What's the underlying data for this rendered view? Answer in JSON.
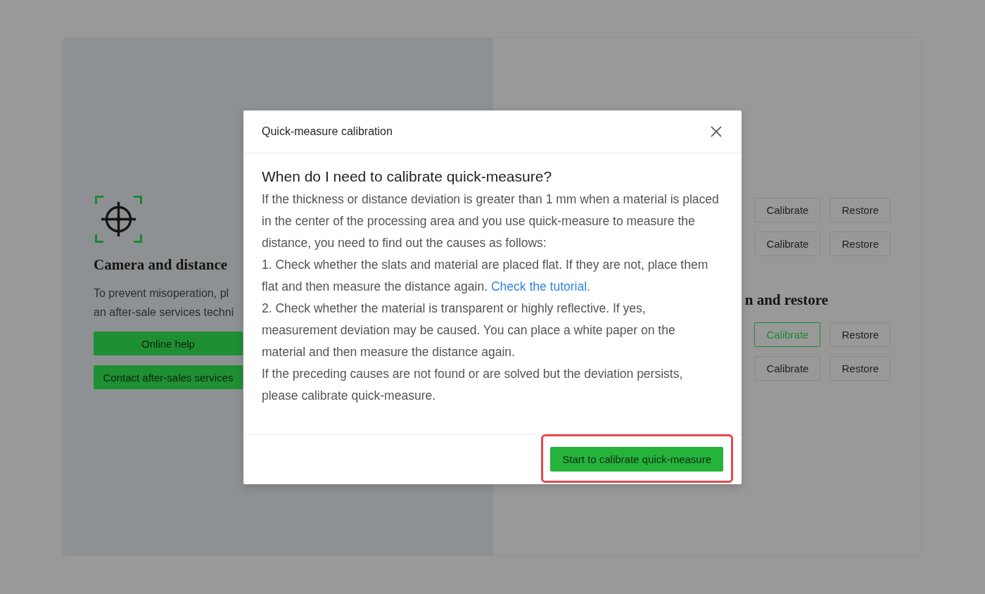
{
  "page": {
    "left_panel": {
      "heading": "Camera and distance",
      "description_lines": [
        "To prevent misoperation, pl",
        "an after-sale services techni"
      ],
      "buttons": [
        "Online help",
        "Contact after-sales services"
      ]
    },
    "right_panel": {
      "groups": [
        {
          "rows": [
            {
              "calibrate": "Calibrate",
              "restore": "Restore",
              "highlighted": false
            },
            {
              "calibrate": "Calibrate",
              "restore": "Restore",
              "highlighted": false
            }
          ]
        },
        {
          "heading": "n and restore",
          "rows": [
            {
              "calibrate": "Calibrate",
              "restore": "Restore",
              "highlighted": true
            },
            {
              "calibrate": "Calibrate",
              "restore": "Restore",
              "highlighted": false
            }
          ]
        }
      ]
    }
  },
  "dialog": {
    "title": "Quick-measure calibration",
    "heading": "When do I need to calibrate quick-measure?",
    "paragraphs": [
      {
        "text": "If the thickness or distance deviation is greater than 1 mm when a material is placed in the center of the processing area and you use quick-measure to measure the distance, you need to find out the causes as follows:"
      },
      {
        "text": "1. Check whether the slats and material are placed flat. If they are not, place them flat and then measure the distance again.",
        "link": "Check the tutorial."
      },
      {
        "text": "2. Check whether the material is transparent or highly reflective. If yes, measurement deviation may be caused. You can place a white paper on the material and then measure the distance again."
      },
      {
        "text": "If the preceding causes are not found or are solved but the deviation persists, please calibrate quick-measure."
      }
    ],
    "primary_button": {
      "label": "Start to calibrate quick-measure",
      "annotated": true
    }
  }
}
